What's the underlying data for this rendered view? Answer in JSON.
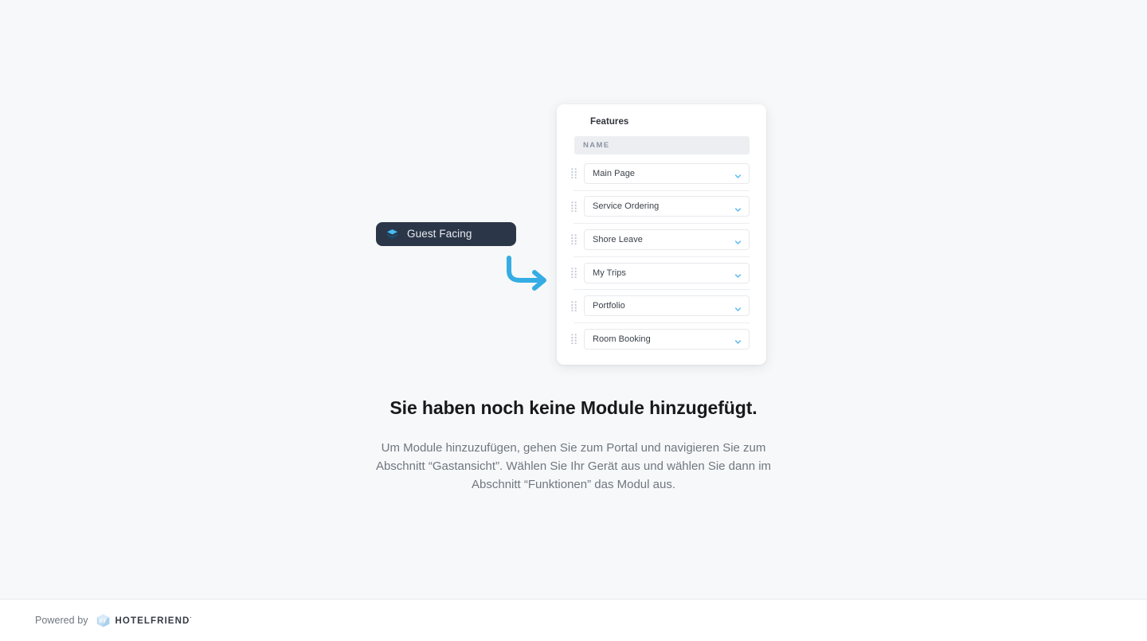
{
  "page": {
    "background_color": "#f7f8f9"
  },
  "badge": {
    "label": "Guest Facing",
    "icon": "layers-icon",
    "background_color": "#2b3648",
    "text_color": "#e9ecf1"
  },
  "arrow": {
    "icon": "curved-arrow-right-icon",
    "color": "#35ade4"
  },
  "features_panel": {
    "title": "Features",
    "column_header": "NAME",
    "accent_color": "#5ebdf0",
    "rows": [
      {
        "label": "Main Page",
        "chevron": "chevron-down-icon",
        "handle": "drag-handle-icon"
      },
      {
        "label": "Service Ordering",
        "chevron": "chevron-down-icon",
        "handle": "drag-handle-icon"
      },
      {
        "label": "Shore Leave",
        "chevron": "chevron-down-icon",
        "handle": "drag-handle-icon"
      },
      {
        "label": "My Trips",
        "chevron": "chevron-down-icon",
        "handle": "drag-handle-icon"
      },
      {
        "label": "Portfolio",
        "chevron": "chevron-down-icon",
        "handle": "drag-handle-icon"
      },
      {
        "label": "Room Booking",
        "chevron": "chevron-down-icon",
        "handle": "drag-handle-icon"
      }
    ]
  },
  "empty_state": {
    "title": "Sie haben noch keine Module hinzugefügt.",
    "description": "Um Module hinzuzufügen, gehen Sie zum Portal und navigieren Sie zum Abschnitt “Gastansicht”. Wählen Sie Ihr Gerät aus und wählen Sie dann im Abschnitt “Funktionen” das Modul aus."
  },
  "footer": {
    "powered_by": "Powered by",
    "brand_name": "HOTELFRIEND",
    "brand_tm": "·",
    "logo_icon": "hotelfriend-cube-icon"
  }
}
